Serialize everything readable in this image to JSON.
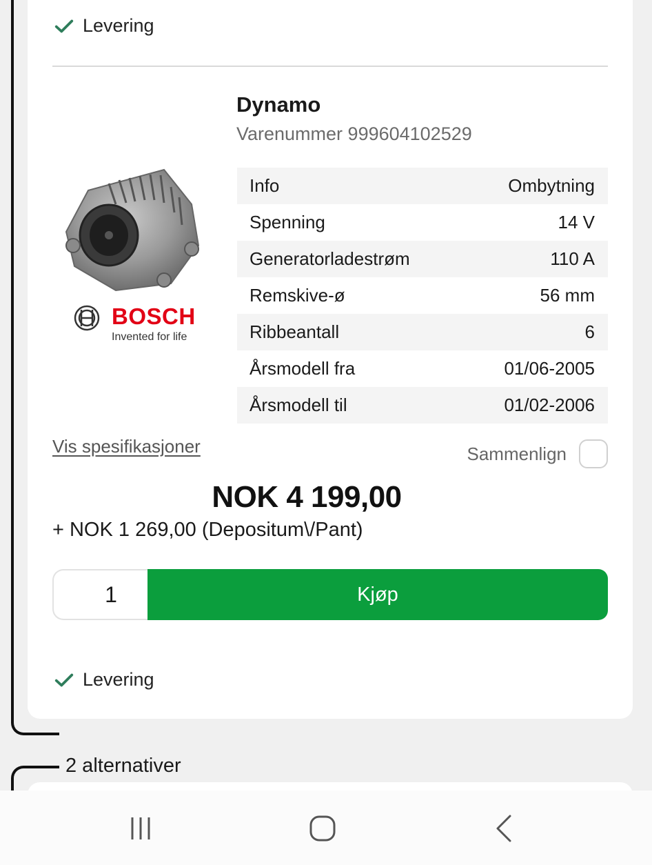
{
  "delivery": {
    "label": "Levering"
  },
  "product": {
    "title": "Dynamo",
    "sku_text": "Varenummer 999604102529",
    "brand": {
      "name": "BOSCH",
      "tagline": "Invented for life"
    }
  },
  "specs": [
    {
      "label": "Info",
      "value": "Ombytning"
    },
    {
      "label": "Spenning",
      "value": "14 V"
    },
    {
      "label": "Generatorladestrøm",
      "value": "110 A"
    },
    {
      "label": "Remskive-ø",
      "value": "56 mm"
    },
    {
      "label": "Ribbeantall",
      "value": "6"
    },
    {
      "label": "Årsmodell fra",
      "value": "01/06-2005"
    },
    {
      "label": "Årsmodell til",
      "value": "01/02-2006"
    }
  ],
  "links": {
    "show_specs": "Vis spesifikasjoner",
    "compare": "Sammenlign"
  },
  "pricing": {
    "price": "NOK 4 199,00",
    "deposit": "+ NOK 1 269,00 (Depositum\\/Pant)"
  },
  "cart": {
    "quantity": "1",
    "buy_label": "Kjøp"
  },
  "alternatives": {
    "label": "2 alternativer"
  },
  "colors": {
    "buy_green": "#0b9e3d",
    "check_green": "#2e7d5b",
    "bosch_red": "#e20015"
  },
  "navbar": {
    "icons": [
      "recent-apps-icon",
      "home-icon",
      "back-icon"
    ]
  }
}
